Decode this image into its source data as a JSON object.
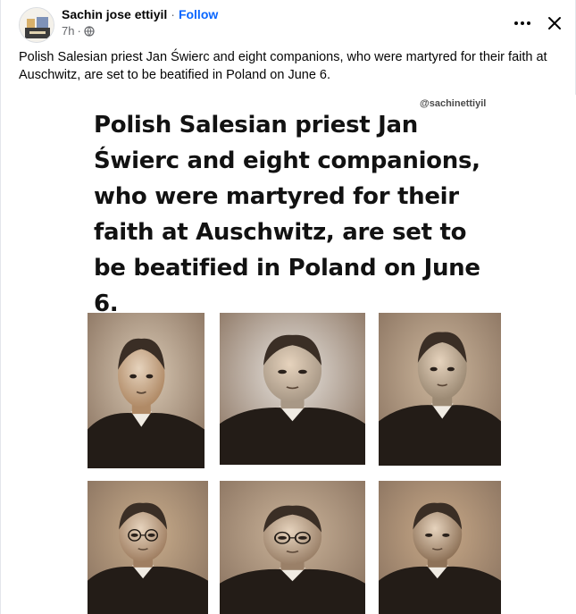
{
  "post": {
    "author": "Sachin jose ettiyil",
    "separator": "·",
    "follow_label": "Follow",
    "time": "7h",
    "time_separator": "·",
    "privacy_icon": "globe-icon",
    "more_icon": "more-dots-icon",
    "close_icon": "close-icon",
    "caption": "Polish Salesian priest Jan Świerc and eight companions, who were martyred for their faith at Auschwitz, are set to be beatified in Poland on June 6."
  },
  "image": {
    "watermark": "@sachinettiyil",
    "headline_lines": [
      "Polish Salesian priest Jan",
      "Świerc and eight companions,",
      "who were martyred for their",
      "faith at Auschwitz, are set to",
      "be beatified in Poland on June",
      "6."
    ],
    "photos": [
      {
        "tone": "#b08a66",
        "bg": "#d9c9b4"
      },
      {
        "tone": "#a89886",
        "bg": "#e8e4df"
      },
      {
        "tone": "#9c8a74",
        "bg": "#cdb79d"
      },
      {
        "tone": "#a07f62",
        "bg": "#c9ad8c"
      },
      {
        "tone": "#9a8068",
        "bg": "#cbb49a"
      },
      {
        "tone": "#8e7258",
        "bg": "#c8a988"
      }
    ]
  },
  "colors": {
    "accent": "#0866ff",
    "text": "#050505",
    "secondary": "#65676b"
  }
}
